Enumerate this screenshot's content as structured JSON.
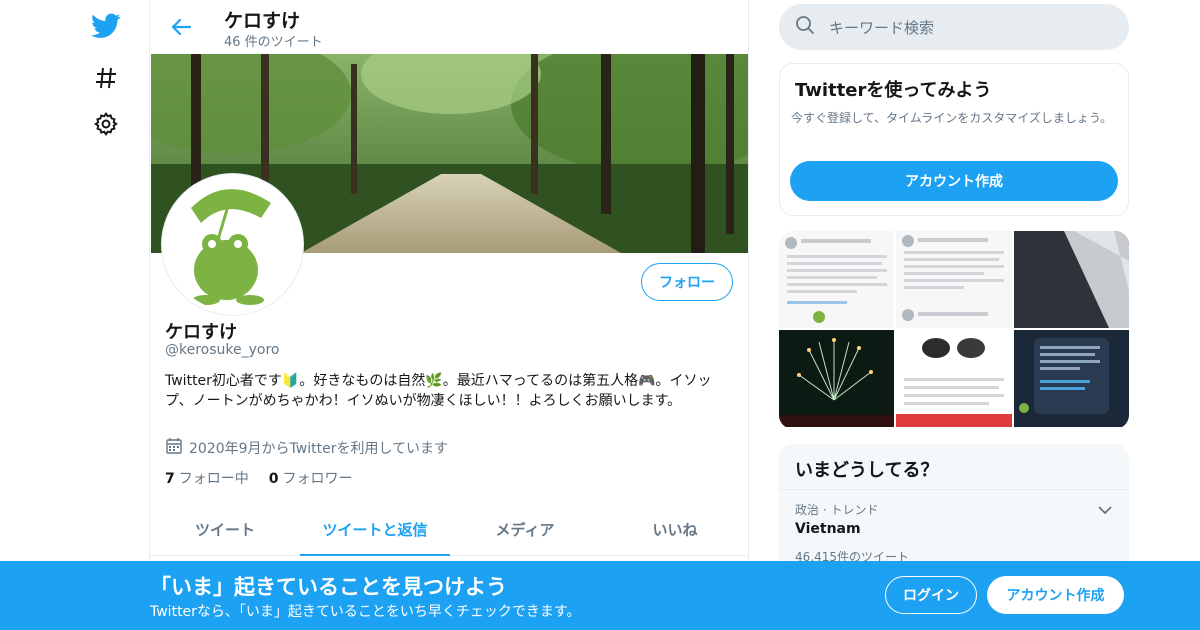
{
  "colors": {
    "accent": "#1da1f2",
    "muted": "#657786",
    "text": "#14171a",
    "border": "#e6ecf0"
  },
  "nav": {
    "icons": [
      "twitter-bird-icon",
      "hashtag-icon",
      "settings-gear-icon"
    ]
  },
  "header": {
    "name": "ケロすけ",
    "tweet_count": "46 件のツイート"
  },
  "profile": {
    "name": "ケロすけ",
    "handle": "@kerosuke_yoro",
    "follow_label": "フォロー",
    "bio": "Twitter初心者です🔰。好きなものは自然🌿。最近ハマってるのは第五人格🎮。イソップ、ノートンがめちゃかわ！イソぬいが物凄くほしい！！よろしくお願いします。",
    "joined": "2020年9月からTwitterを利用しています",
    "following_count": "7",
    "following_label": "フォロー中",
    "followers_count": "0",
    "followers_label": "フォロワー"
  },
  "tabs": [
    {
      "label": "ツイート",
      "active": false
    },
    {
      "label": "ツイートと返信",
      "active": true
    },
    {
      "label": "メディア",
      "active": false
    },
    {
      "label": "いいね",
      "active": false
    }
  ],
  "search": {
    "placeholder": "キーワード検索"
  },
  "signup_card": {
    "title": "Twitterを使ってみよう",
    "description": "今すぐ登録して、タイムラインをカスタマイズしましょう。",
    "button": "アカウント作成"
  },
  "trends": {
    "title": "いまどうしてる？",
    "items": [
      {
        "meta": "政治 · トレンド",
        "name": "Vietnam",
        "count": "46,415件のツイート"
      }
    ]
  },
  "bottom_bar": {
    "title": "「いま」起きていることを見つけよう",
    "subtitle": "Twitterなら、「いま」起きていることをいち早くチェックできます。",
    "login": "ログイン",
    "signup": "アカウント作成"
  }
}
